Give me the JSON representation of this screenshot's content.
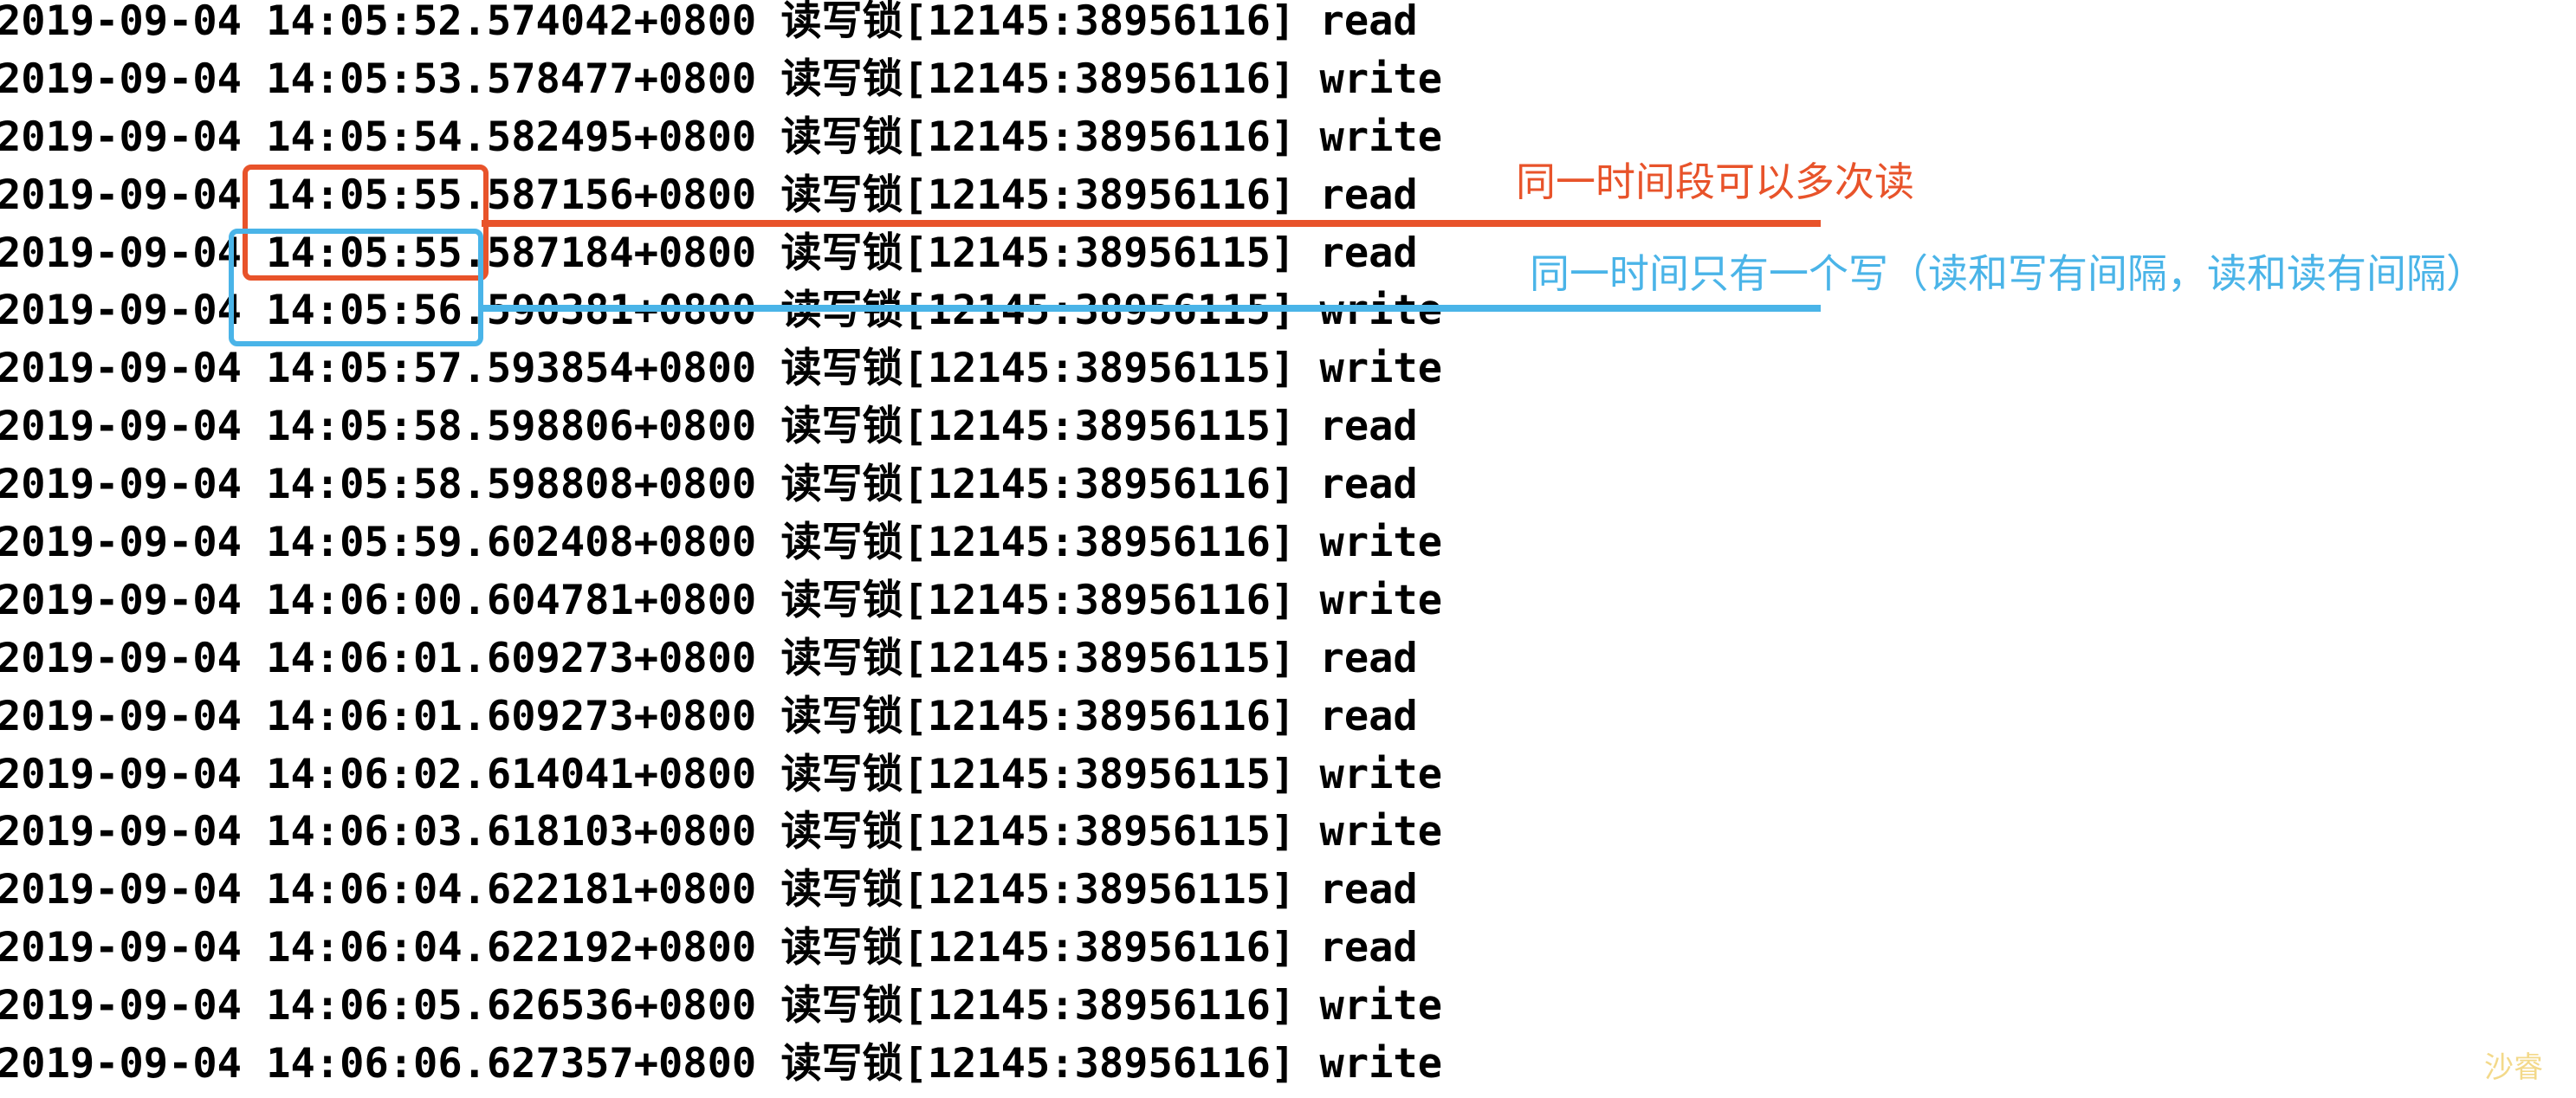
{
  "log": {
    "lines": [
      {
        "date": "2019-09-04",
        "time": "14:05:52.574042+0800",
        "label": "读写锁[12145:38956116]",
        "op": "read"
      },
      {
        "date": "2019-09-04",
        "time": "14:05:53.578477+0800",
        "label": "读写锁[12145:38956116]",
        "op": "write"
      },
      {
        "date": "2019-09-04",
        "time": "14:05:54.582495+0800",
        "label": "读写锁[12145:38956116]",
        "op": "write"
      },
      {
        "date": "2019-09-04",
        "time": "14:05:55.587156+0800",
        "label": "读写锁[12145:38956116]",
        "op": "read"
      },
      {
        "date": "2019-09-04",
        "time": "14:05:55.587184+0800",
        "label": "读写锁[12145:38956115]",
        "op": "read"
      },
      {
        "date": "2019-09-04",
        "time": "14:05:56.590381+0800",
        "label": "读写锁[12145:38956115]",
        "op": "write"
      },
      {
        "date": "2019-09-04",
        "time": "14:05:57.593854+0800",
        "label": "读写锁[12145:38956115]",
        "op": "write"
      },
      {
        "date": "2019-09-04",
        "time": "14:05:58.598806+0800",
        "label": "读写锁[12145:38956115]",
        "op": "read"
      },
      {
        "date": "2019-09-04",
        "time": "14:05:58.598808+0800",
        "label": "读写锁[12145:38956116]",
        "op": "read"
      },
      {
        "date": "2019-09-04",
        "time": "14:05:59.602408+0800",
        "label": "读写锁[12145:38956116]",
        "op": "write"
      },
      {
        "date": "2019-09-04",
        "time": "14:06:00.604781+0800",
        "label": "读写锁[12145:38956116]",
        "op": "write"
      },
      {
        "date": "2019-09-04",
        "time": "14:06:01.609273+0800",
        "label": "读写锁[12145:38956115]",
        "op": "read"
      },
      {
        "date": "2019-09-04",
        "time": "14:06:01.609273+0800",
        "label": "读写锁[12145:38956116]",
        "op": "read"
      },
      {
        "date": "2019-09-04",
        "time": "14:06:02.614041+0800",
        "label": "读写锁[12145:38956115]",
        "op": "write"
      },
      {
        "date": "2019-09-04",
        "time": "14:06:03.618103+0800",
        "label": "读写锁[12145:38956115]",
        "op": "write"
      },
      {
        "date": "2019-09-04",
        "time": "14:06:04.622181+0800",
        "label": "读写锁[12145:38956115]",
        "op": "read"
      },
      {
        "date": "2019-09-04",
        "time": "14:06:04.622192+0800",
        "label": "读写锁[12145:38956116]",
        "op": "read"
      },
      {
        "date": "2019-09-04",
        "time": "14:06:05.626536+0800",
        "label": "读写锁[12145:38956116]",
        "op": "write"
      },
      {
        "date": "2019-09-04",
        "time": "14:06:06.627357+0800",
        "label": "读写锁[12145:38956116]",
        "op": "write"
      }
    ]
  },
  "annotations": {
    "read_note": {
      "text": "同一时间段可以多次读",
      "color": "#e8532a"
    },
    "write_note": {
      "text": "同一时间只有一个写（读和写有间隔，读和读有间隔）",
      "color": "#4ab4e8"
    }
  },
  "watermark": {
    "text": "沙睿",
    "color": "#f3d98a"
  }
}
